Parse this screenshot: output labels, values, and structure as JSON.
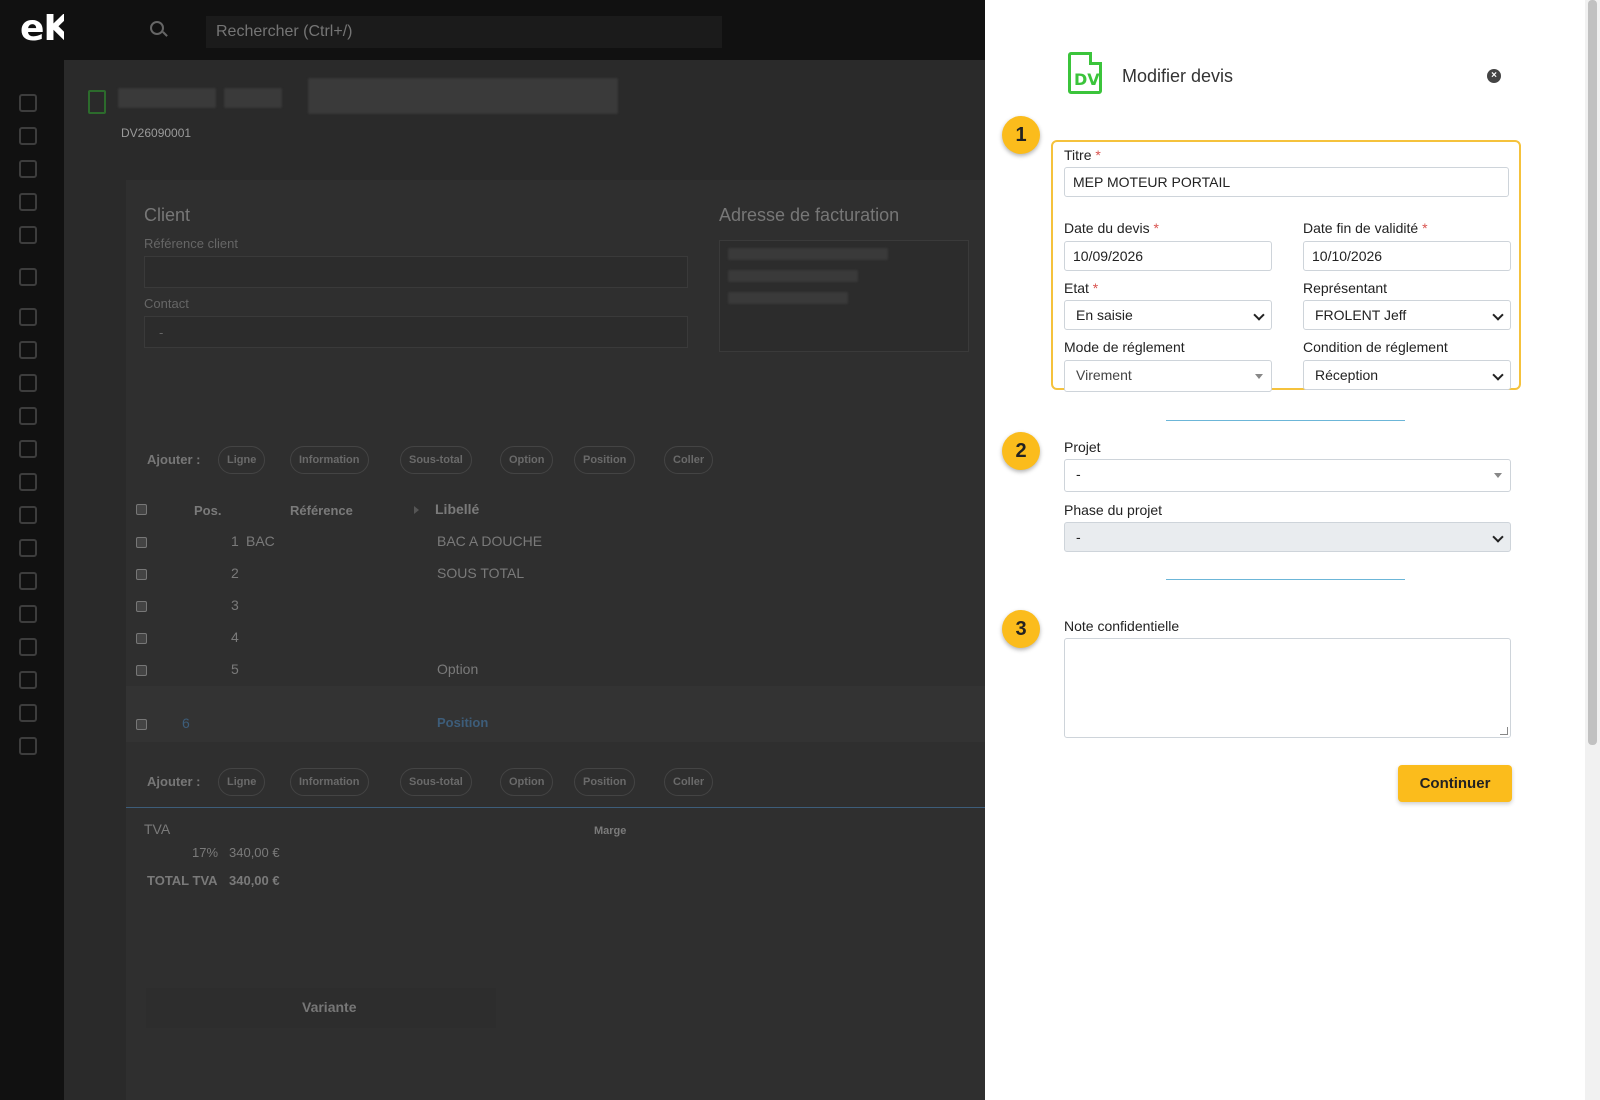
{
  "app": {
    "logo": "eKo"
  },
  "search": {
    "placeholder": "Rechercher (Ctrl+/)"
  },
  "background": {
    "doc_number": "DV26090001",
    "client_heading": "Client",
    "reference_label": "Référence client",
    "contact_label": "Contact",
    "contact_value": "-",
    "billing_heading": "Adresse de facturation",
    "add_label": "Ajouter :",
    "add_buttons": [
      "Ligne",
      "Information",
      "Sous-total",
      "Option",
      "Position",
      "Coller"
    ],
    "table_headers": {
      "pos": "Pos.",
      "reference": "Référence",
      "label": "Libellé"
    },
    "rows": [
      {
        "pos": "1",
        "reference": "BAC",
        "label": "BAC A DOUCHE"
      },
      {
        "pos": "2",
        "reference": "",
        "label": "SOUS TOTAL"
      },
      {
        "pos": "3",
        "reference": "",
        "label": ""
      },
      {
        "pos": "4",
        "reference": "",
        "label": ""
      },
      {
        "pos": "5",
        "reference": "",
        "label": "Option"
      },
      {
        "pos": "6",
        "reference": "",
        "label": "Position"
      }
    ],
    "tva_label": "TVA",
    "tva_rate": "17%",
    "tva_amount": "340,00 €",
    "marge_label": "Marge",
    "total_tva_label": "TOTAL TVA",
    "total_tva_amount": "340,00 €",
    "variante_label": "Variante"
  },
  "modal": {
    "icon_text": "DV",
    "title": "Modifier devis",
    "steps": [
      "1",
      "2",
      "3"
    ],
    "titre_label": "Titre",
    "titre_value": "MEP MOTEUR PORTAIL",
    "date_devis_label": "Date du devis",
    "date_devis_value": "10/09/2026",
    "date_fin_label": "Date fin de validité",
    "date_fin_value": "10/10/2026",
    "etat_label": "Etat",
    "etat_value": "En saisie",
    "representant_label": "Représentant",
    "representant_value": "FROLENT Jeff",
    "mode_label": "Mode de réglement",
    "mode_value": "Virement",
    "condition_label": "Condition de réglement",
    "condition_value": "Réception",
    "projet_label": "Projet",
    "projet_value": "-",
    "phase_label": "Phase du projet",
    "phase_value": "-",
    "note_label": "Note confidentielle",
    "continue_label": "Continuer"
  },
  "colors": {
    "accent": "#fbbc1c",
    "doc_icon": "#3bc43b",
    "divider": "#6cb6d8",
    "required": "#d9534f"
  }
}
